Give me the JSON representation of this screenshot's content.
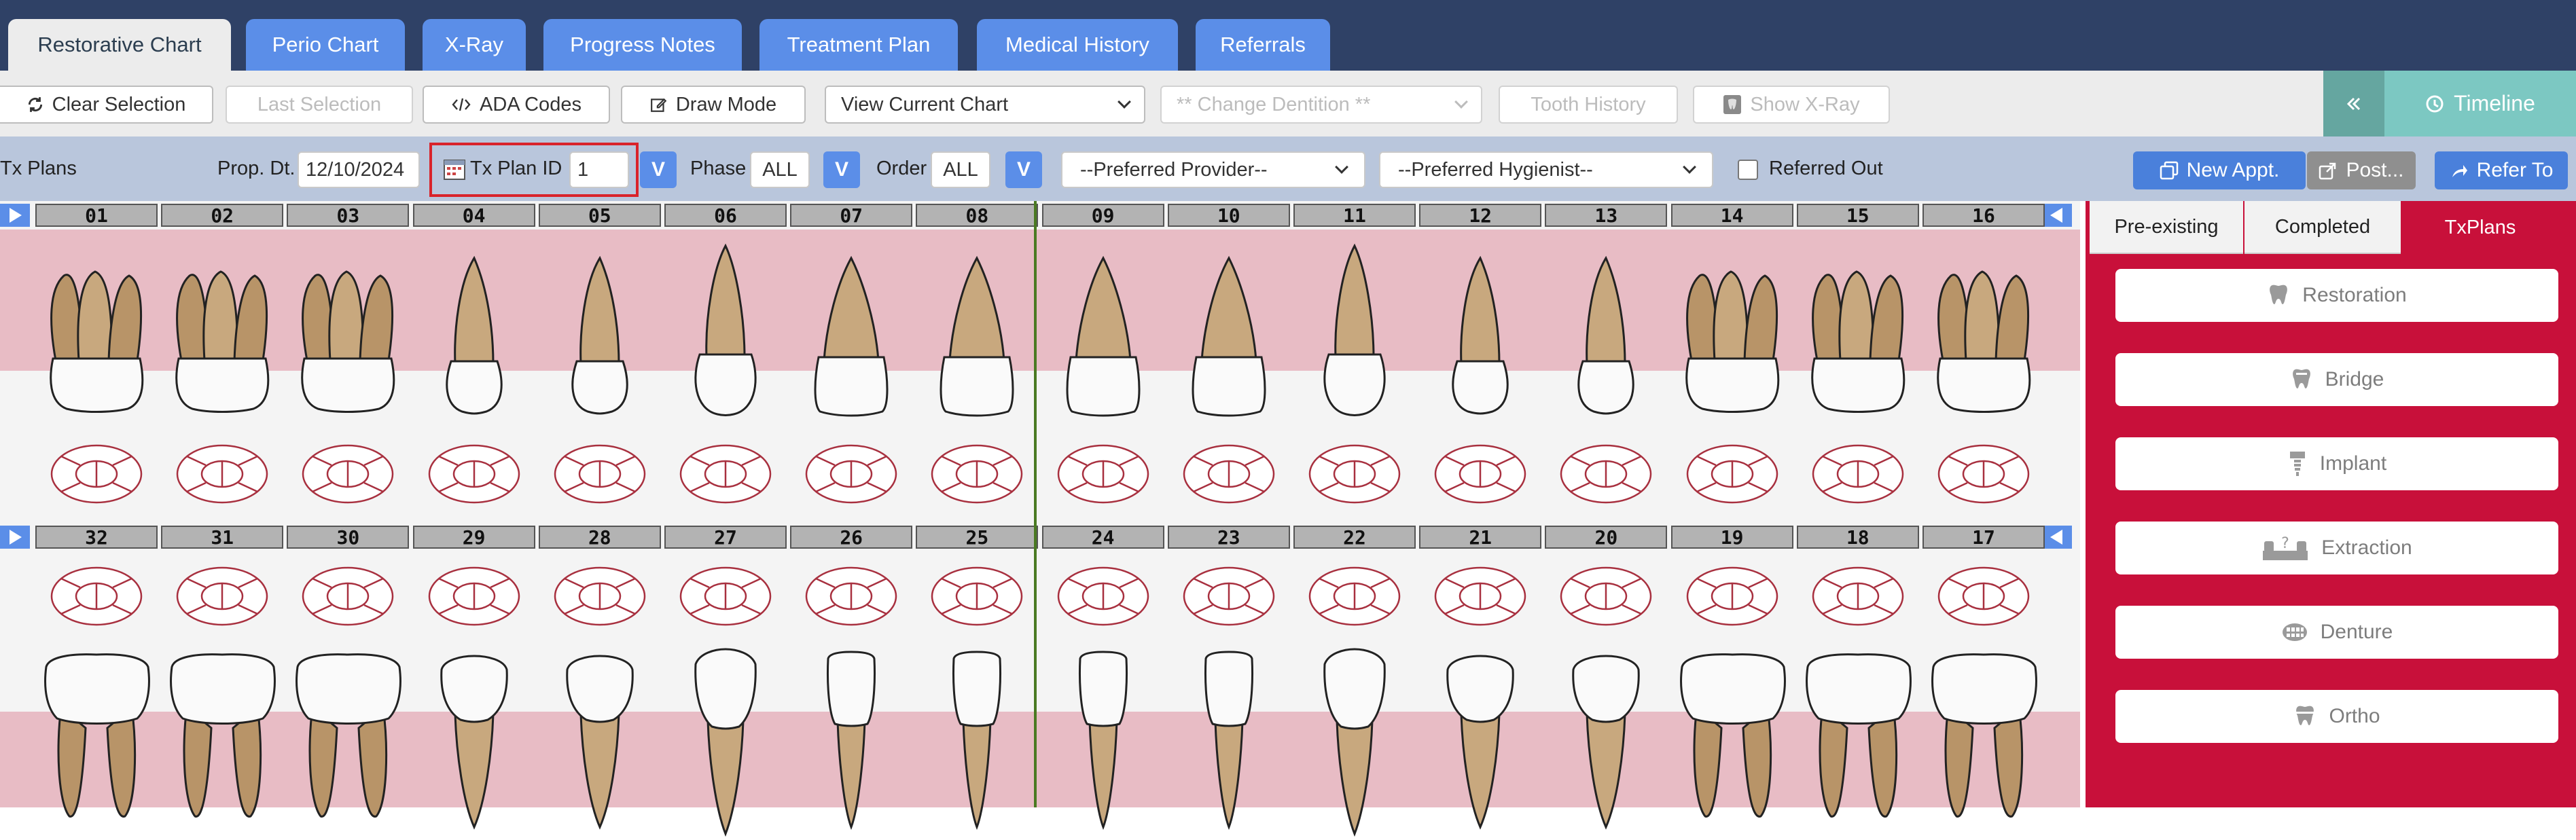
{
  "nav": {
    "tabs": [
      {
        "label": "Restorative Chart",
        "active": true
      },
      {
        "label": "Perio Chart"
      },
      {
        "label": "X-Ray"
      },
      {
        "label": "Progress Notes"
      },
      {
        "label": "Treatment Plan"
      },
      {
        "label": "Medical History"
      },
      {
        "label": "Referrals"
      }
    ]
  },
  "toolbar": {
    "clear_selection": "Clear Selection",
    "last_selection": "Last Selection",
    "ada_codes": "ADA Codes",
    "draw_mode": "Draw Mode",
    "view_chart": "View Current Chart",
    "change_dentition": "** Change Dentition **",
    "tooth_history": "Tooth History",
    "show_xray": "Show X-Ray",
    "timeline": "Timeline"
  },
  "filters": {
    "tx_plans": "Tx Plans",
    "prop_dt_label": "Prop. Dt.",
    "prop_dt_value": "12/10/2024",
    "tx_plan_id_label": "Tx Plan ID",
    "tx_plan_id_value": "1",
    "v": "V",
    "phase_label": "Phase",
    "phase_value": "ALL",
    "order_label": "Order",
    "order_value": "ALL",
    "provider": "--Preferred Provider--",
    "hygienist": "--Preferred Hygienist--",
    "referred_out": "Referred Out",
    "new_appt": "New Appt.",
    "post": "Post...",
    "refer_to": "Refer To"
  },
  "chart": {
    "upper_numbers": [
      "01",
      "02",
      "03",
      "04",
      "05",
      "06",
      "07",
      "08",
      "09",
      "10",
      "11",
      "12",
      "13",
      "14",
      "15",
      "16"
    ],
    "lower_numbers": [
      "32",
      "31",
      "30",
      "29",
      "28",
      "27",
      "26",
      "25",
      "24",
      "23",
      "22",
      "21",
      "20",
      "19",
      "18",
      "17"
    ]
  },
  "panel": {
    "tabs": [
      "Pre-existing",
      "Completed",
      "TxPlans"
    ],
    "active_tab": "TxPlans",
    "buttons": [
      {
        "label": "Restoration",
        "icon": "tooth-icon"
      },
      {
        "label": "Bridge",
        "icon": "bridge-icon"
      },
      {
        "label": "Implant",
        "icon": "implant-icon"
      },
      {
        "label": "Extraction",
        "icon": "extraction-icon"
      },
      {
        "label": "Denture",
        "icon": "denture-icon"
      },
      {
        "label": "Ortho",
        "icon": "ortho-icon"
      }
    ]
  },
  "colors": {
    "nav_bg": "#2f4166",
    "tab_blue": "#5b8ee8",
    "gum_pink": "#e8bcc5",
    "panel_red": "#c8103a",
    "timeline_teal": "#7cc8c2"
  }
}
